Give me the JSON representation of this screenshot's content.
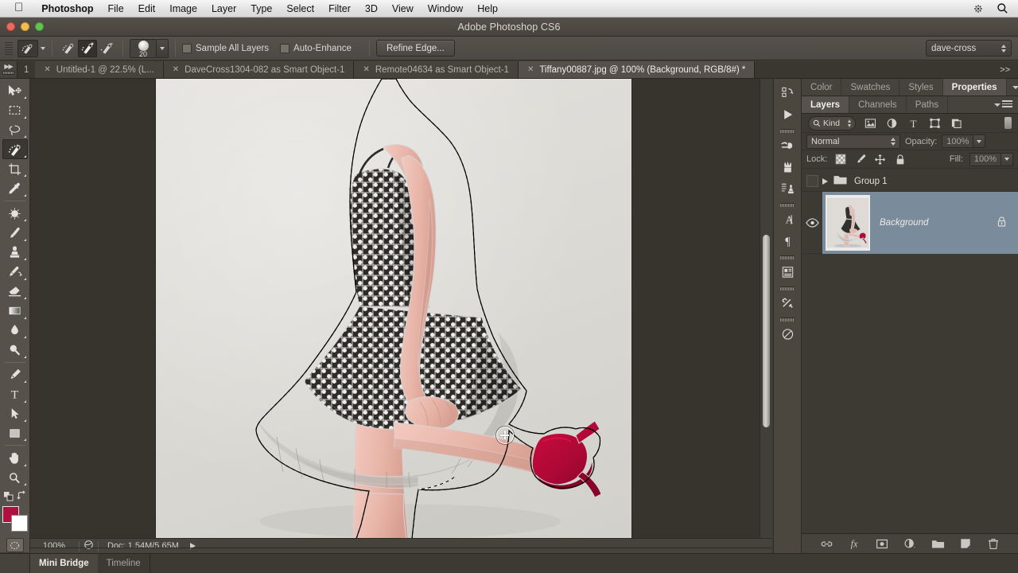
{
  "mac_menu": {
    "apple_icon": "apple-icon",
    "items": [
      {
        "label": "Photoshop",
        "bold": true
      },
      {
        "label": "File"
      },
      {
        "label": "Edit"
      },
      {
        "label": "Image"
      },
      {
        "label": "Layer"
      },
      {
        "label": "Type"
      },
      {
        "label": "Select"
      },
      {
        "label": "Filter"
      },
      {
        "label": "3D"
      },
      {
        "label": "View"
      },
      {
        "label": "Window"
      },
      {
        "label": "Help"
      }
    ],
    "right_icons": [
      "spotlight-sparkle-icon",
      "search-icon"
    ]
  },
  "window": {
    "title": "Adobe Photoshop CS6",
    "traffic_lights": [
      "close-button",
      "minimize-button",
      "zoom-button"
    ]
  },
  "options_bar": {
    "tool_preset_label": "quick-selection-tool-preset",
    "modes": [
      {
        "name": "new-selection",
        "active": false
      },
      {
        "name": "add-to-selection",
        "active": true
      },
      {
        "name": "subtract-from-selection",
        "active": false
      }
    ],
    "brush_size": "20",
    "checkboxes": [
      {
        "label": "Sample All Layers",
        "checked": false
      },
      {
        "label": "Auto-Enhance",
        "checked": false
      }
    ],
    "refine_edge_label": "Refine Edge...",
    "workspace": "dave-cross"
  },
  "tab_bar": {
    "left_number": "1",
    "tabs": [
      {
        "label": "Untitled-1 @ 22.5% (L...",
        "active": false
      },
      {
        "label": "DaveCross1304-082 as Smart Object-1",
        "active": false
      },
      {
        "label": "Remote04634 as Smart Object-1",
        "active": false
      },
      {
        "label": "Tiffany00887.jpg @ 100% (Background, RGB/8#) *",
        "active": true
      }
    ],
    "overflow_label": ">>"
  },
  "toolbar": {
    "tools": [
      {
        "name": "move-tool",
        "active": false
      },
      {
        "name": "rectangular-marquee-tool",
        "active": false
      },
      {
        "name": "lasso-tool",
        "active": false
      },
      {
        "name": "quick-selection-tool",
        "active": true
      },
      {
        "name": "crop-tool",
        "active": false
      },
      {
        "name": "eyedropper-tool",
        "active": false
      },
      {
        "name": "spot-healing-brush-tool",
        "active": false
      },
      {
        "name": "brush-tool",
        "active": false
      },
      {
        "name": "clone-stamp-tool",
        "active": false
      },
      {
        "name": "history-brush-tool",
        "active": false
      },
      {
        "name": "eraser-tool",
        "active": false
      },
      {
        "name": "gradient-tool",
        "active": false
      },
      {
        "name": "blur-tool",
        "active": false
      },
      {
        "name": "dodge-tool",
        "active": false
      },
      {
        "name": "pen-tool",
        "active": false
      },
      {
        "name": "type-tool",
        "active": false
      },
      {
        "name": "path-selection-tool",
        "active": false
      },
      {
        "name": "rectangle-tool",
        "active": false
      },
      {
        "name": "hand-tool",
        "active": false
      },
      {
        "name": "zoom-tool",
        "active": false
      }
    ],
    "foreground_color": "#b01040",
    "background_color": "#ffffff",
    "quick_mask_name": "quick-mask-mode"
  },
  "canvas": {
    "zoom": "100%",
    "doc_info": "Doc: 1.54M/5.65M",
    "image_description": "woman-in-polka-dot-dress-red-heels",
    "cursor": "quick-selection-brush-cursor"
  },
  "right_dock": {
    "icons": [
      "history-icon",
      "actions-play-icon",
      "brush-presets-icon",
      "brush-tip-icon",
      "tool-presets-icon",
      "character-icon",
      "paragraph-icon",
      "notes-icon",
      "adjustments-icon",
      "masks-icon"
    ]
  },
  "panels": {
    "top_group": {
      "tabs": [
        {
          "label": "Color",
          "active": false
        },
        {
          "label": "Swatches",
          "active": false
        },
        {
          "label": "Styles",
          "active": false
        },
        {
          "label": "Properties",
          "active": true
        }
      ],
      "menu_icon": "panel-menu-icon"
    },
    "layers_group": {
      "tabs": [
        {
          "label": "Layers",
          "active": true
        },
        {
          "label": "Channels",
          "active": false
        },
        {
          "label": "Paths",
          "active": false
        }
      ],
      "menu_icon": "panel-menu-icon"
    },
    "layer_filter": {
      "kind_label": "Kind",
      "filter_icons": [
        "pixel-layer-filter-icon",
        "adjustment-layer-filter-icon",
        "type-layer-filter-icon",
        "shape-layer-filter-icon",
        "smart-object-filter-icon"
      ],
      "toggle_name": "filter-enable-toggle"
    },
    "blend_row": {
      "blend_mode": "Normal",
      "opacity_label": "Opacity:",
      "opacity_value": "100%"
    },
    "lock_row": {
      "lock_label": "Lock:",
      "lock_icons": [
        "lock-transparent-pixels-icon",
        "lock-image-pixels-icon",
        "lock-position-icon",
        "lock-all-icon"
      ],
      "fill_label": "Fill:",
      "fill_value": "100%"
    },
    "layers": [
      {
        "type": "group",
        "name": "Group 1",
        "visible": false,
        "selected": false,
        "expanded": false
      },
      {
        "type": "layer",
        "name": "Background",
        "visible": true,
        "selected": true,
        "locked": true
      }
    ],
    "footer_buttons": [
      "link-layers-icon",
      "layer-style-fx-icon",
      "add-layer-mask-icon",
      "new-adjustment-layer-icon",
      "new-group-icon",
      "new-layer-icon",
      "delete-layer-icon"
    ]
  },
  "bottom_bar": {
    "tabs": [
      {
        "label": "Mini Bridge",
        "active": true
      },
      {
        "label": "Timeline",
        "active": false
      }
    ]
  },
  "colors": {
    "app_background": "#3d3a34",
    "canvas_surround": "#37332d",
    "panel_background": "#46423c",
    "selected_layer": "#7a8b9c",
    "accent_red": "#b01040"
  }
}
